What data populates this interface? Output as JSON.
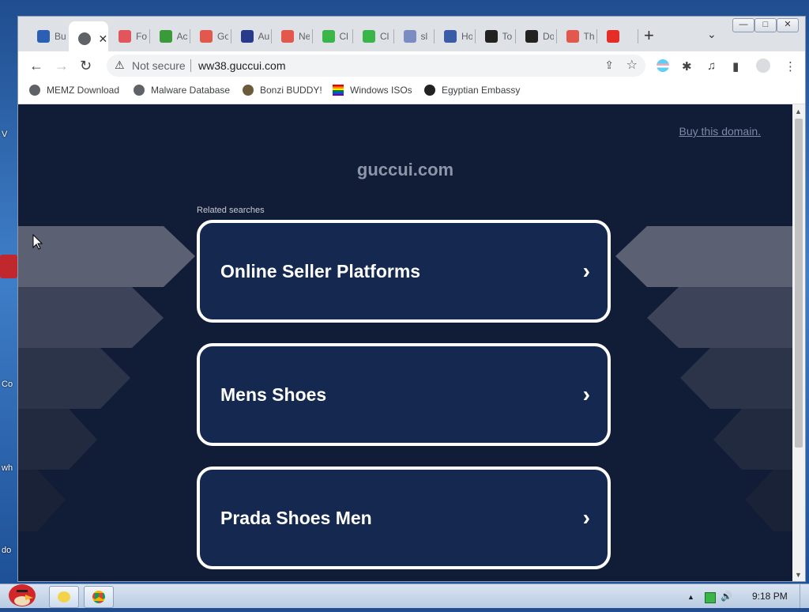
{
  "desktop": {
    "fragments": [
      "V",
      "Co",
      "wh",
      "do"
    ]
  },
  "window_controls": {
    "minimize": "—",
    "maximize": "□",
    "close": "✕"
  },
  "tabs": [
    {
      "label": "Bu",
      "icon": "bucket-icon",
      "color": "#2b5fb4"
    },
    {
      "label": "",
      "icon": "globe-icon",
      "color": "#5f6368",
      "active": true
    },
    {
      "label": "Fo",
      "icon": "x-circle-icon",
      "color": "#e0565b"
    },
    {
      "label": "Ac",
      "icon": "clover-icon",
      "color": "#3a9a3a"
    },
    {
      "label": "Go",
      "icon": "go-icon",
      "color": "#e2584d"
    },
    {
      "label": "Au",
      "icon": "shield-icon",
      "color": "#2a3a8a"
    },
    {
      "label": "Ne",
      "icon": "go-icon",
      "color": "#e2584d"
    },
    {
      "label": "Cl",
      "icon": "bolt-icon",
      "color": "#39b54a"
    },
    {
      "label": "Cl",
      "icon": "bolt-icon",
      "color": "#39b54a"
    },
    {
      "label": "sl",
      "icon": "info-icon",
      "color": "#7a8cc2"
    },
    {
      "label": "Ho",
      "icon": "flag-icon",
      "color": "#3a5ba8"
    },
    {
      "label": "To",
      "icon": "horse-icon",
      "color": "#222222"
    },
    {
      "label": "Do",
      "icon": "d-icon",
      "color": "#222222"
    },
    {
      "label": "Th",
      "icon": "burger-icon",
      "color": "#e2584d"
    },
    {
      "label": "",
      "icon": "youtube-icon",
      "color": "#e52d27"
    }
  ],
  "active_tab_close": "✕",
  "new_tab": "+",
  "tab_search": "⌄",
  "toolbar": {
    "back": "←",
    "forward": "→",
    "reload": "↻",
    "security_icon": "⚠",
    "security_text": "Not secure",
    "url": "ww38.guccui.com",
    "share": "⇪",
    "bookmark_star": "☆",
    "extensions": "✱",
    "media": "♫",
    "sidepanel": "▮",
    "profile": "●",
    "menu": "⋮"
  },
  "bookmarks": [
    {
      "label": "MEMZ Download",
      "icon": "globe-icon",
      "color": "#5f6368"
    },
    {
      "label": "Malware Database",
      "icon": "globe-icon",
      "color": "#5f6368"
    },
    {
      "label": "Bonzi BUDDY!",
      "icon": "bonzi-icon",
      "color": "#6b5b3a"
    },
    {
      "label": "Windows ISOs",
      "icon": "rainbow-flag-icon",
      "color": "#e040a0"
    },
    {
      "label": "Egyptian Embassy",
      "icon": "wix-icon",
      "color": "#222222"
    }
  ],
  "page": {
    "buy_link": "Buy this domain.",
    "domain": "guccui.com",
    "related_label": "Related searches",
    "cards": [
      {
        "title": "Online Seller Platforms",
        "arrow": "›"
      },
      {
        "title": "Mens Shoes",
        "arrow": "›"
      },
      {
        "title": "Prada Shoes Men",
        "arrow": "›"
      }
    ],
    "background_color": "#111c36",
    "card_color": "#142850"
  },
  "taskbar": {
    "clock": "9:18 PM",
    "tray_arrow": "▲",
    "volume": "🔊"
  }
}
